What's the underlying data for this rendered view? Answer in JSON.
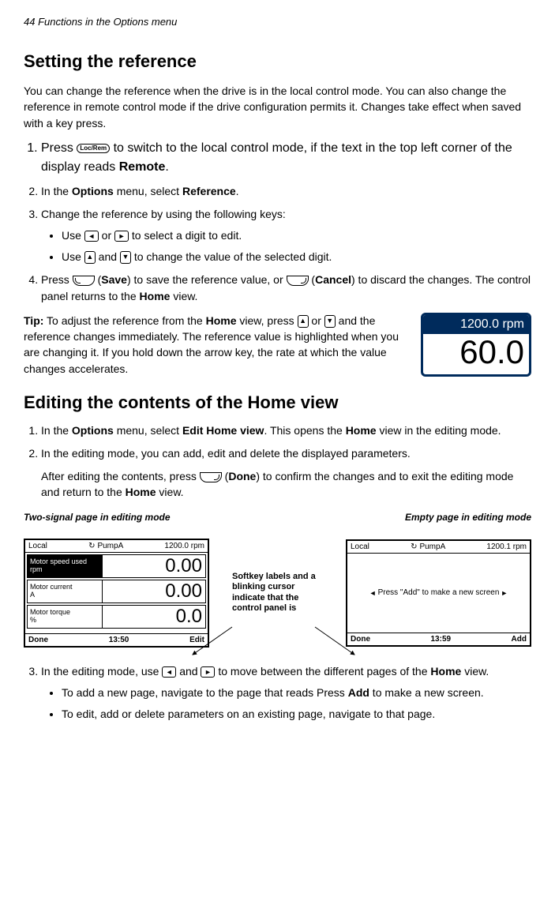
{
  "page_header": "44    Functions in the Options menu",
  "h1": "Setting the reference",
  "intro": "You can change the reference when the drive is in the local control mode. You can also change the reference in remote control mode if the drive configuration permits it. Changes take effect when saved with a key press.",
  "key_locrem": "Loc/Rem",
  "step1_a": "Press ",
  "step1_b": " to switch to the local control mode, if the text in the top left corner of the display reads ",
  "step1_remote": "Remote",
  "step2_a": "In the ",
  "step2_options": "Options",
  "step2_b": " menu, select ",
  "step2_ref": "Reference",
  "step3": "Change the reference by using the following keys:",
  "bullet1_a": "Use ",
  "bullet1_b": " or ",
  "bullet1_c": " to select a digit to edit.",
  "bullet2_a": "Use ",
  "bullet2_b": " and ",
  "bullet2_c": " to change the value of the selected digit.",
  "step4_a": "Press ",
  "step4_save": "Save",
  "step4_b": ") to save the reference value, or ",
  "step4_cancel": "Cancel",
  "step4_c": ") to discard the changes. The control panel returns to the ",
  "step4_home": "Home",
  "step4_d": " view.",
  "tip_a": "Tip:",
  "tip_b": " To adjust the reference from the ",
  "tip_home": "Home",
  "tip_c": " view, press ",
  "tip_d": " or ",
  "tip_e": " and the reference changes immediately. The reference value is highlighted when you are changing it. If you hold down the arrow key, the rate at which the value changes accelerates.",
  "rpm_top": "1200.0 rpm",
  "rpm_bottom": "60.0",
  "h2": "Editing the contents of the Home view",
  "edit_step1_a": "In the ",
  "edit_step1_b": " menu, select ",
  "edit_step1_edithome": "Edit Home view",
  "edit_step1_c": ". This opens the ",
  "edit_step1_d": " view in the editing mode.",
  "edit_step2": "In the editing mode, you can add, edit and delete the displayed parameters.",
  "edit_step2b_a": "After editing the contents, press ",
  "edit_step2b_done": "Done",
  "edit_step2b_b": ") to confirm the changes and to exit the editing mode and return to the ",
  "edit_step2b_c": " view.",
  "label_left": "Two-signal page in editing mode",
  "label_right": "Empty page in editing mode",
  "annotation": "Softkey labels and a blinking cursor indicate that the control panel is",
  "panel1": {
    "hdr_left": "Local",
    "hdr_mid": "PumpA",
    "hdr_right": "1200.0 rpm",
    "row1_label1": "Motor speed used",
    "row1_label2": "rpm",
    "row1_val": "0.00",
    "row2_label1": "Motor current",
    "row2_label2": "A",
    "row2_val": "0.00",
    "row3_label1": "Motor torque",
    "row3_label2": "%",
    "row3_val": "0.0",
    "ftr_left": "Done",
    "ftr_mid": "13:50",
    "ftr_right": "Edit"
  },
  "panel2": {
    "hdr_left": "Local",
    "hdr_mid": "PumpA",
    "hdr_right": "1200.1 rpm",
    "body": "Press \"Add\" to make a new screen",
    "ftr_left": "Done",
    "ftr_mid": "13:59",
    "ftr_right": "Add"
  },
  "edit_step3_a": "In the editing mode, use ",
  "edit_step3_b": " and ",
  "edit_step3_c": " to move between the different pages of the ",
  "edit_step3_d": " view.",
  "edit_bullet1_a": "To add a new page, navigate to the page that reads Press ",
  "edit_bullet1_add": "Add",
  "edit_bullet1_b": " to make a new screen.",
  "edit_bullet2": "To edit, add or delete parameters on an existing page, navigate to that page."
}
